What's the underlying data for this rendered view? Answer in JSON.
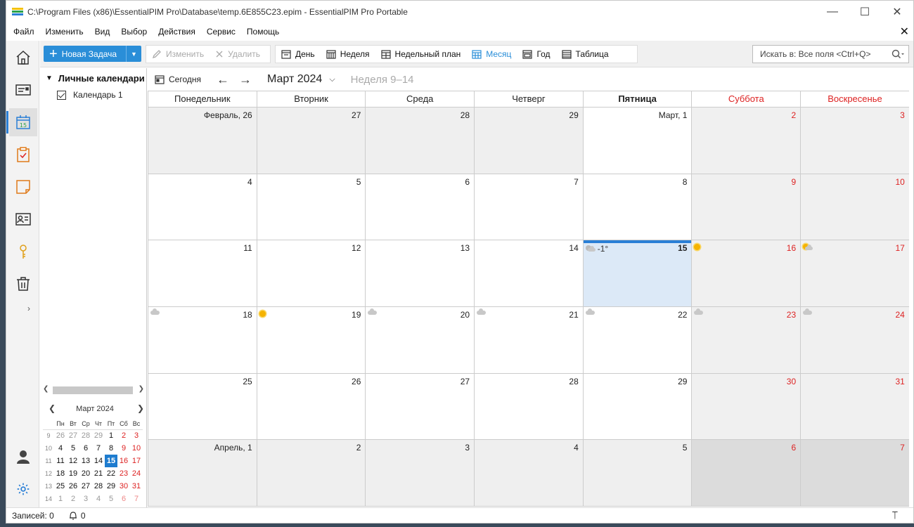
{
  "window": {
    "title": "C:\\Program Files (x86)\\EssentialPIM Pro\\Database\\temp.6E855C23.epim - EssentialPIM Pro Portable",
    "min": "—",
    "max": "☐",
    "close": "✕"
  },
  "menu": [
    "Файл",
    "Изменить",
    "Вид",
    "Выбор",
    "Действия",
    "Сервис",
    "Помощь"
  ],
  "menu_close": "✕",
  "toolbar": {
    "new_task": "Новая Задача",
    "edit": "Изменить",
    "delete": "Удалить",
    "views": [
      "День",
      "Неделя",
      "Недельный план",
      "Месяц",
      "Год",
      "Таблица"
    ],
    "active_view": "Месяц",
    "search_placeholder": "Искать в: Все поля  <Ctrl+Q>"
  },
  "calendars": {
    "header": "Личные календари",
    "items": [
      "Календарь 1"
    ]
  },
  "nav": {
    "today": "Сегодня",
    "month": "Март 2024",
    "weeks": "Неделя 9–14"
  },
  "colors": {
    "accent": "#2a7fd6",
    "weekend": "#dd2222",
    "today_bg": "#dce9f7"
  },
  "days_of_week": [
    "Понедельник",
    "Вторник",
    "Среда",
    "Четверг",
    "Пятница",
    "Суббота",
    "Воскресенье"
  ],
  "weeks": [
    [
      {
        "label": "Февраль, 26",
        "other": true
      },
      {
        "label": "27",
        "other": true
      },
      {
        "label": "28",
        "other": true
      },
      {
        "label": "29",
        "other": true
      },
      {
        "label": "Март, 1"
      },
      {
        "label": "2"
      },
      {
        "label": "3"
      }
    ],
    [
      {
        "label": "4"
      },
      {
        "label": "5"
      },
      {
        "label": "6"
      },
      {
        "label": "7"
      },
      {
        "label": "8"
      },
      {
        "label": "9"
      },
      {
        "label": "10"
      }
    ],
    [
      {
        "label": "11"
      },
      {
        "label": "12"
      },
      {
        "label": "13"
      },
      {
        "label": "14"
      },
      {
        "label": "15",
        "today": true,
        "weather": "moon-cloud",
        "temp": "-1°"
      },
      {
        "label": "16",
        "weather": "sun"
      },
      {
        "label": "17",
        "weather": "sun-cloud"
      }
    ],
    [
      {
        "label": "18",
        "weather": "cloud"
      },
      {
        "label": "19",
        "weather": "sun"
      },
      {
        "label": "20",
        "weather": "cloud"
      },
      {
        "label": "21",
        "weather": "cloud"
      },
      {
        "label": "22",
        "weather": "cloud"
      },
      {
        "label": "23",
        "weather": "cloud"
      },
      {
        "label": "24",
        "weather": "cloud"
      }
    ],
    [
      {
        "label": "25"
      },
      {
        "label": "26"
      },
      {
        "label": "27"
      },
      {
        "label": "28"
      },
      {
        "label": "29"
      },
      {
        "label": "30"
      },
      {
        "label": "31"
      }
    ],
    [
      {
        "label": "Апрель, 1",
        "other": true
      },
      {
        "label": "2",
        "other": true
      },
      {
        "label": "3",
        "other": true
      },
      {
        "label": "4",
        "other": true
      },
      {
        "label": "5",
        "other": true
      },
      {
        "label": "6",
        "other": true
      },
      {
        "label": "7",
        "other": true
      }
    ]
  ],
  "mini_calendar": {
    "title": "Март  2024",
    "headers": [
      "Пн",
      "Вт",
      "Ср",
      "Чт",
      "Пт",
      "Сб",
      "Вс"
    ],
    "rows": [
      {
        "week": "9",
        "days": [
          "26",
          "27",
          "28",
          "29",
          "1",
          "2",
          "3"
        ],
        "other": [
          0,
          1,
          2,
          3
        ]
      },
      {
        "week": "10",
        "days": [
          "4",
          "5",
          "6",
          "7",
          "8",
          "9",
          "10"
        ],
        "other": []
      },
      {
        "week": "11",
        "days": [
          "11",
          "12",
          "13",
          "14",
          "15",
          "16",
          "17"
        ],
        "other": [],
        "today": 4
      },
      {
        "week": "12",
        "days": [
          "18",
          "19",
          "20",
          "21",
          "22",
          "23",
          "24"
        ],
        "other": []
      },
      {
        "week": "13",
        "days": [
          "25",
          "26",
          "27",
          "28",
          "29",
          "30",
          "31"
        ],
        "other": []
      },
      {
        "week": "14",
        "days": [
          "1",
          "2",
          "3",
          "4",
          "5",
          "6",
          "7"
        ],
        "other": [
          0,
          1,
          2,
          3,
          4,
          5,
          6
        ]
      }
    ]
  },
  "status": {
    "records": "Записей: 0",
    "reminders": "0"
  }
}
